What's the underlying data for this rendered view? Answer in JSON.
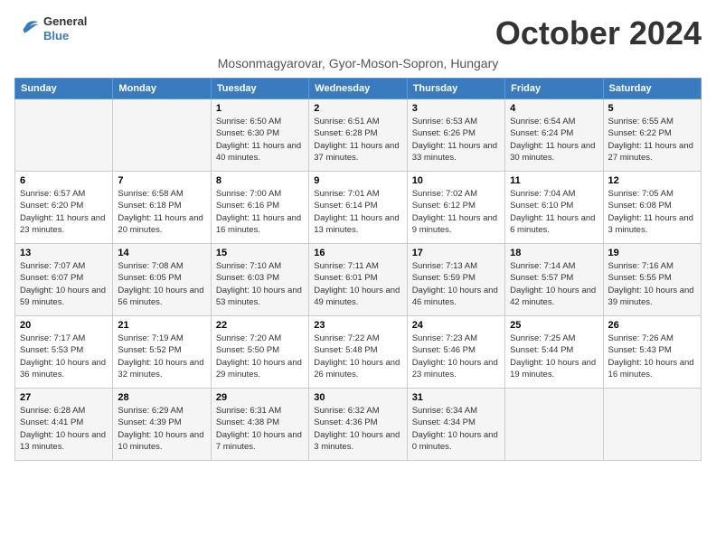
{
  "logo": {
    "text_general": "General",
    "text_blue": "Blue"
  },
  "header": {
    "month_title": "October 2024",
    "subtitle": "Mosonmagyarovar, Gyor-Moson-Sopron, Hungary"
  },
  "days_of_week": [
    "Sunday",
    "Monday",
    "Tuesday",
    "Wednesday",
    "Thursday",
    "Friday",
    "Saturday"
  ],
  "weeks": [
    [
      {
        "day": "",
        "sunrise": "",
        "sunset": "",
        "daylight": ""
      },
      {
        "day": "",
        "sunrise": "",
        "sunset": "",
        "daylight": ""
      },
      {
        "day": "1",
        "sunrise": "Sunrise: 6:50 AM",
        "sunset": "Sunset: 6:30 PM",
        "daylight": "Daylight: 11 hours and 40 minutes."
      },
      {
        "day": "2",
        "sunrise": "Sunrise: 6:51 AM",
        "sunset": "Sunset: 6:28 PM",
        "daylight": "Daylight: 11 hours and 37 minutes."
      },
      {
        "day": "3",
        "sunrise": "Sunrise: 6:53 AM",
        "sunset": "Sunset: 6:26 PM",
        "daylight": "Daylight: 11 hours and 33 minutes."
      },
      {
        "day": "4",
        "sunrise": "Sunrise: 6:54 AM",
        "sunset": "Sunset: 6:24 PM",
        "daylight": "Daylight: 11 hours and 30 minutes."
      },
      {
        "day": "5",
        "sunrise": "Sunrise: 6:55 AM",
        "sunset": "Sunset: 6:22 PM",
        "daylight": "Daylight: 11 hours and 27 minutes."
      }
    ],
    [
      {
        "day": "6",
        "sunrise": "Sunrise: 6:57 AM",
        "sunset": "Sunset: 6:20 PM",
        "daylight": "Daylight: 11 hours and 23 minutes."
      },
      {
        "day": "7",
        "sunrise": "Sunrise: 6:58 AM",
        "sunset": "Sunset: 6:18 PM",
        "daylight": "Daylight: 11 hours and 20 minutes."
      },
      {
        "day": "8",
        "sunrise": "Sunrise: 7:00 AM",
        "sunset": "Sunset: 6:16 PM",
        "daylight": "Daylight: 11 hours and 16 minutes."
      },
      {
        "day": "9",
        "sunrise": "Sunrise: 7:01 AM",
        "sunset": "Sunset: 6:14 PM",
        "daylight": "Daylight: 11 hours and 13 minutes."
      },
      {
        "day": "10",
        "sunrise": "Sunrise: 7:02 AM",
        "sunset": "Sunset: 6:12 PM",
        "daylight": "Daylight: 11 hours and 9 minutes."
      },
      {
        "day": "11",
        "sunrise": "Sunrise: 7:04 AM",
        "sunset": "Sunset: 6:10 PM",
        "daylight": "Daylight: 11 hours and 6 minutes."
      },
      {
        "day": "12",
        "sunrise": "Sunrise: 7:05 AM",
        "sunset": "Sunset: 6:08 PM",
        "daylight": "Daylight: 11 hours and 3 minutes."
      }
    ],
    [
      {
        "day": "13",
        "sunrise": "Sunrise: 7:07 AM",
        "sunset": "Sunset: 6:07 PM",
        "daylight": "Daylight: 10 hours and 59 minutes."
      },
      {
        "day": "14",
        "sunrise": "Sunrise: 7:08 AM",
        "sunset": "Sunset: 6:05 PM",
        "daylight": "Daylight: 10 hours and 56 minutes."
      },
      {
        "day": "15",
        "sunrise": "Sunrise: 7:10 AM",
        "sunset": "Sunset: 6:03 PM",
        "daylight": "Daylight: 10 hours and 53 minutes."
      },
      {
        "day": "16",
        "sunrise": "Sunrise: 7:11 AM",
        "sunset": "Sunset: 6:01 PM",
        "daylight": "Daylight: 10 hours and 49 minutes."
      },
      {
        "day": "17",
        "sunrise": "Sunrise: 7:13 AM",
        "sunset": "Sunset: 5:59 PM",
        "daylight": "Daylight: 10 hours and 46 minutes."
      },
      {
        "day": "18",
        "sunrise": "Sunrise: 7:14 AM",
        "sunset": "Sunset: 5:57 PM",
        "daylight": "Daylight: 10 hours and 42 minutes."
      },
      {
        "day": "19",
        "sunrise": "Sunrise: 7:16 AM",
        "sunset": "Sunset: 5:55 PM",
        "daylight": "Daylight: 10 hours and 39 minutes."
      }
    ],
    [
      {
        "day": "20",
        "sunrise": "Sunrise: 7:17 AM",
        "sunset": "Sunset: 5:53 PM",
        "daylight": "Daylight: 10 hours and 36 minutes."
      },
      {
        "day": "21",
        "sunrise": "Sunrise: 7:19 AM",
        "sunset": "Sunset: 5:52 PM",
        "daylight": "Daylight: 10 hours and 32 minutes."
      },
      {
        "day": "22",
        "sunrise": "Sunrise: 7:20 AM",
        "sunset": "Sunset: 5:50 PM",
        "daylight": "Daylight: 10 hours and 29 minutes."
      },
      {
        "day": "23",
        "sunrise": "Sunrise: 7:22 AM",
        "sunset": "Sunset: 5:48 PM",
        "daylight": "Daylight: 10 hours and 26 minutes."
      },
      {
        "day": "24",
        "sunrise": "Sunrise: 7:23 AM",
        "sunset": "Sunset: 5:46 PM",
        "daylight": "Daylight: 10 hours and 23 minutes."
      },
      {
        "day": "25",
        "sunrise": "Sunrise: 7:25 AM",
        "sunset": "Sunset: 5:44 PM",
        "daylight": "Daylight: 10 hours and 19 minutes."
      },
      {
        "day": "26",
        "sunrise": "Sunrise: 7:26 AM",
        "sunset": "Sunset: 5:43 PM",
        "daylight": "Daylight: 10 hours and 16 minutes."
      }
    ],
    [
      {
        "day": "27",
        "sunrise": "Sunrise: 6:28 AM",
        "sunset": "Sunset: 4:41 PM",
        "daylight": "Daylight: 10 hours and 13 minutes."
      },
      {
        "day": "28",
        "sunrise": "Sunrise: 6:29 AM",
        "sunset": "Sunset: 4:39 PM",
        "daylight": "Daylight: 10 hours and 10 minutes."
      },
      {
        "day": "29",
        "sunrise": "Sunrise: 6:31 AM",
        "sunset": "Sunset: 4:38 PM",
        "daylight": "Daylight: 10 hours and 7 minutes."
      },
      {
        "day": "30",
        "sunrise": "Sunrise: 6:32 AM",
        "sunset": "Sunset: 4:36 PM",
        "daylight": "Daylight: 10 hours and 3 minutes."
      },
      {
        "day": "31",
        "sunrise": "Sunrise: 6:34 AM",
        "sunset": "Sunset: 4:34 PM",
        "daylight": "Daylight: 10 hours and 0 minutes."
      },
      {
        "day": "",
        "sunrise": "",
        "sunset": "",
        "daylight": ""
      },
      {
        "day": "",
        "sunrise": "",
        "sunset": "",
        "daylight": ""
      }
    ]
  ]
}
